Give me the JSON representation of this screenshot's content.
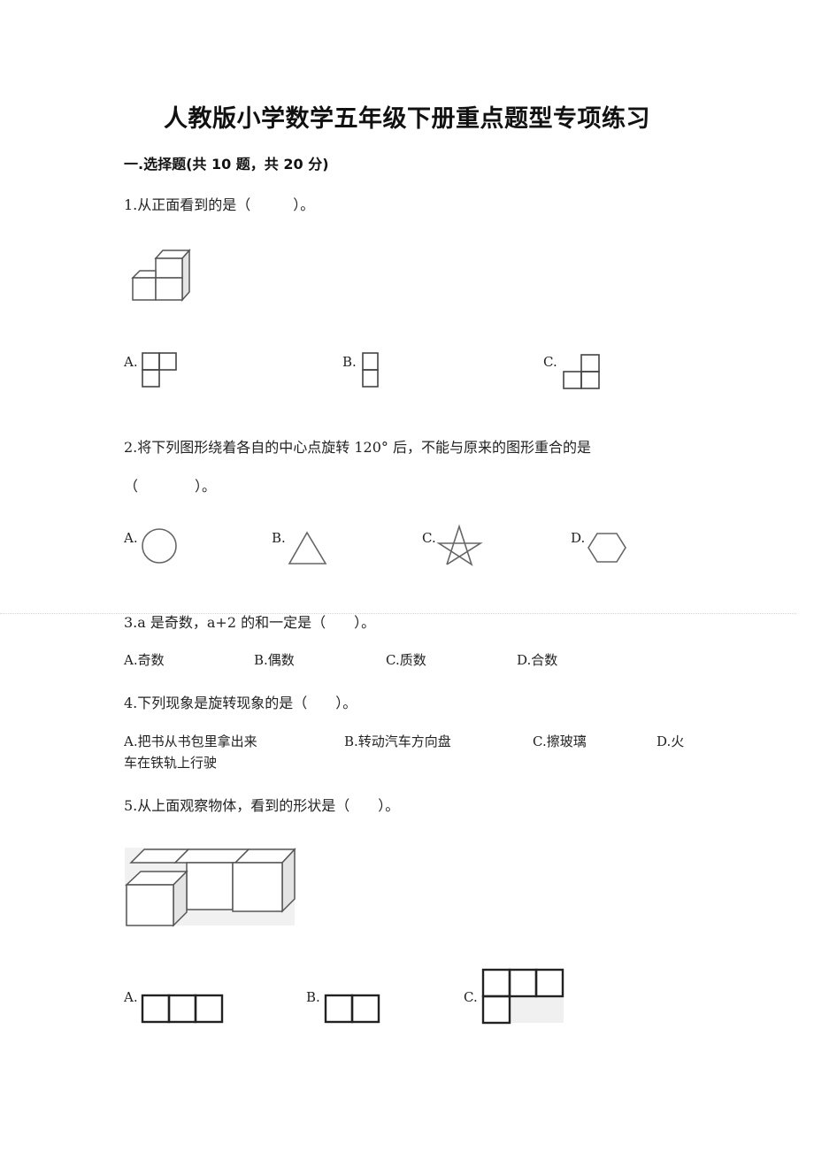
{
  "title": "人教版小学数学五年级下册重点题型专项练习",
  "section": "一.选择题(共 10 题，共 20 分)",
  "questions": [
    {
      "number": "1",
      "text": "1.从正面看到的是（　　　）。",
      "figure": "l-shaped-cube-stack",
      "options": [
        {
          "label": "A.",
          "figure": "three-squares-top-row-two"
        },
        {
          "label": "B.",
          "figure": "two-squares-vertical"
        },
        {
          "label": "C.",
          "figure": "three-squares-bottom-row-two"
        }
      ]
    },
    {
      "number": "2",
      "text": "2.将下列图形绕着各自的中心点旋转 120° 后，不能与原来的图形重合的是",
      "text_cont": "（　　　　）。",
      "options": [
        {
          "label": "A.",
          "figure": "circle"
        },
        {
          "label": "B.",
          "figure": "triangle"
        },
        {
          "label": "C.",
          "figure": "star"
        },
        {
          "label": "D.",
          "figure": "hexagon"
        }
      ]
    },
    {
      "number": "3",
      "text": "3.a 是奇数，a+2 的和一定是（　　）。",
      "options": [
        {
          "label": "A.奇数"
        },
        {
          "label": "B.偶数"
        },
        {
          "label": "C.质数"
        },
        {
          "label": "D.合数"
        }
      ]
    },
    {
      "number": "4",
      "text": "4.下列现象是旋转现象的是（　　）。",
      "options": [
        {
          "label": "A.把书从书包里拿出来"
        },
        {
          "label": "B.转动汽车方向盘"
        },
        {
          "label": "C.擦玻璃"
        },
        {
          "label": "D.火"
        }
      ],
      "options_cont": "车在铁轨上行驶"
    },
    {
      "number": "5",
      "text": "5.从上面观察物体，看到的形状是（　　）。",
      "figure": "four-cube-arrangement",
      "options": [
        {
          "label": "A.",
          "figure": "three-squares-row"
        },
        {
          "label": "B.",
          "figure": "two-squares-row"
        },
        {
          "label": "C.",
          "figure": "three-squares-top-one-bottom-left"
        }
      ]
    }
  ]
}
